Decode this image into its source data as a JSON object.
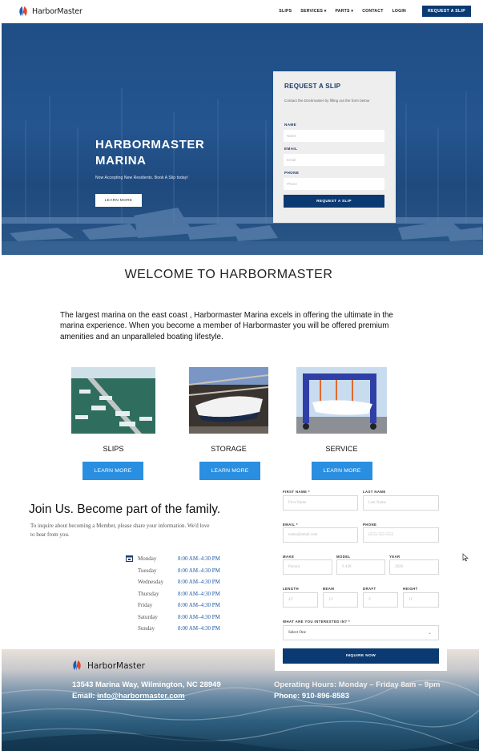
{
  "nav": {
    "brand": "HarborMaster",
    "links": [
      "SLIPS",
      "SERVICES",
      "PARTS",
      "CONTACT",
      "LOGIN"
    ],
    "cta": "REQUEST A SLIP",
    "accent": "#0b3a72"
  },
  "hero": {
    "title": "HARBORMASTER MARINA",
    "subtitle": "Now Accepting New Residents.  Book A Slip today!",
    "button": "LEARN MORE"
  },
  "slip_form": {
    "title": "REQUEST A SLIP",
    "description": "Contact the Dockmaster by filling out the form below",
    "fields": [
      {
        "label": "NAME",
        "placeholder": "Name"
      },
      {
        "label": "EMAIL",
        "placeholder": "Email"
      },
      {
        "label": "PHONE",
        "placeholder": "Phone"
      }
    ],
    "submit": "REQUEST A SLIP"
  },
  "welcome": {
    "title": "WELCOME TO HARBORMASTER",
    "text": "The largest marina on the east coast , Harbormaster Marina excels in offering the ultimate in the marina experience. When you become a member of Harbormaster you will be offered premium amenities and an unparalleled boating lifestyle."
  },
  "services": [
    {
      "label": "SLIPS",
      "button": "LEARN MORE"
    },
    {
      "label": "STORAGE",
      "button": "LEARN MORE"
    },
    {
      "label": "SERVICE",
      "button": "LEARN MORE"
    }
  ],
  "join": {
    "title": "Join Us. Become part of the family.",
    "text": "To inquire about becoming a Member, please share your information. We'd love to hear from you.",
    "hours": [
      {
        "day": "Monday",
        "time": "8:00 AM–4:30 PM"
      },
      {
        "day": "Tuesday",
        "time": "8:00 AM–4:30 PM"
      },
      {
        "day": "Wednesday",
        "time": "8:00 AM–4:30 PM"
      },
      {
        "day": "Thursday",
        "time": "8:00 AM–4:30 PM"
      },
      {
        "day": "Friday",
        "time": "8:00 AM–4:30 PM"
      },
      {
        "day": "Saturday",
        "time": "8:00 AM–4:30 PM"
      },
      {
        "day": "Sunday",
        "time": "8:00 AM–4:30 PM"
      }
    ]
  },
  "inquiry_form": {
    "first_name": {
      "label": "FIRST NAME *",
      "placeholder": "First Name"
    },
    "last_name": {
      "label": "LAST NAME",
      "placeholder": "Last Name"
    },
    "email": {
      "label": "EMAIL *",
      "placeholder": "name@email.com"
    },
    "phone": {
      "label": "PHONE",
      "placeholder": "(555) 555-5555"
    },
    "make": {
      "label": "MAKE",
      "placeholder": "Pursuit"
    },
    "model": {
      "label": "MODEL",
      "placeholder": "S 428"
    },
    "year": {
      "label": "YEAR",
      "placeholder": "2020"
    },
    "length": {
      "label": "LENGTH",
      "placeholder": "43'"
    },
    "beam": {
      "label": "BEAM",
      "placeholder": "13'"
    },
    "draft": {
      "label": "DRAFT",
      "placeholder": "3'"
    },
    "height": {
      "label": "HEIGHT",
      "placeholder": "11'"
    },
    "interest": {
      "label": "WHAT ARE YOU INTERESTED IN? *",
      "value": "Select One"
    },
    "submit": "INQUIRE NOW"
  },
  "footer": {
    "brand": "HarborMaster",
    "address": "13543 Marina Way, Wilmington, NC 28949",
    "email_label": "Email: ",
    "email": "info@harbormaster.com",
    "hours": "Operating Hours: Monday – Friday 8am – 9pm",
    "phone": "Phone:  910-896-8583"
  },
  "icons": [
    "logo-icon",
    "caret-down-icon",
    "calendar-icon",
    "chevron-down-icon",
    "cursor-icon"
  ]
}
